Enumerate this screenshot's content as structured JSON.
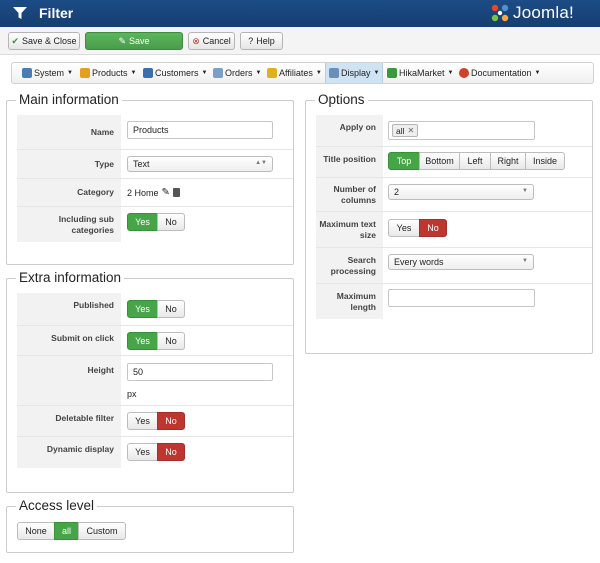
{
  "header": {
    "title": "Filter",
    "logo_text": "Joomla!"
  },
  "toolbar": {
    "save_close": "Save & Close",
    "save": "Save",
    "cancel": "Cancel",
    "help": "Help"
  },
  "menu": [
    {
      "label": "System",
      "icon": "system-icon",
      "color": "#4a7bb7"
    },
    {
      "label": "Products",
      "icon": "products-icon",
      "color": "#e0a020"
    },
    {
      "label": "Customers",
      "icon": "customers-icon",
      "color": "#3c6fb0"
    },
    {
      "label": "Orders",
      "icon": "orders-icon",
      "color": "#7aa0c8"
    },
    {
      "label": "Affiliates",
      "icon": "affiliates-icon",
      "color": "#e0b020"
    },
    {
      "label": "Display",
      "icon": "display-icon",
      "color": "#6b8fb8"
    },
    {
      "label": "HikaMarket",
      "icon": "hikamarket-icon",
      "color": "#3a9a3a"
    },
    {
      "label": "Documentation",
      "icon": "documentation-icon",
      "color": "#d0402a"
    }
  ],
  "main_info": {
    "legend": "Main information",
    "name_label": "Name",
    "name_value": "Products",
    "type_label": "Type",
    "type_value": "Text",
    "category_label": "Category",
    "category_value": "2 Home",
    "include_sub_label": "Including sub categories",
    "include_sub_yes": "Yes",
    "include_sub_no": "No",
    "include_sub_selected": "Yes"
  },
  "extra_info": {
    "legend": "Extra information",
    "published_label": "Published",
    "published": {
      "yes": "Yes",
      "no": "No",
      "selected": "Yes"
    },
    "submit_label": "Submit on click",
    "submit": {
      "yes": "Yes",
      "no": "No",
      "selected": "Yes"
    },
    "height_label": "Height",
    "height_value": "50",
    "height_unit": "px",
    "deletable_label": "Deletable filter",
    "deletable": {
      "yes": "Yes",
      "no": "No",
      "selected": "No"
    },
    "dynamic_label": "Dynamic display",
    "dynamic": {
      "yes": "Yes",
      "no": "No",
      "selected": "No"
    }
  },
  "access": {
    "legend": "Access level",
    "options": [
      "None",
      "all",
      "Custom"
    ],
    "selected": "all"
  },
  "options": {
    "legend": "Options",
    "apply_label": "Apply on",
    "apply_tag": "all",
    "title_pos_label": "Title position",
    "title_pos_options": [
      "Top",
      "Bottom",
      "Left",
      "Right",
      "Inside"
    ],
    "title_pos_selected": "Top",
    "columns_label": "Number of columns",
    "columns_value": "2",
    "max_text_label": "Maximum text size",
    "max_text": {
      "yes": "Yes",
      "no": "No",
      "selected": "No"
    },
    "search_label": "Search processing",
    "search_value": "Every words",
    "max_length_label": "Maximum length",
    "max_length_value": ""
  },
  "colors": {
    "header": "#1c4c86",
    "green": "#46a546",
    "red": "#bd362f",
    "accent_blue": "#cfe3f3"
  }
}
